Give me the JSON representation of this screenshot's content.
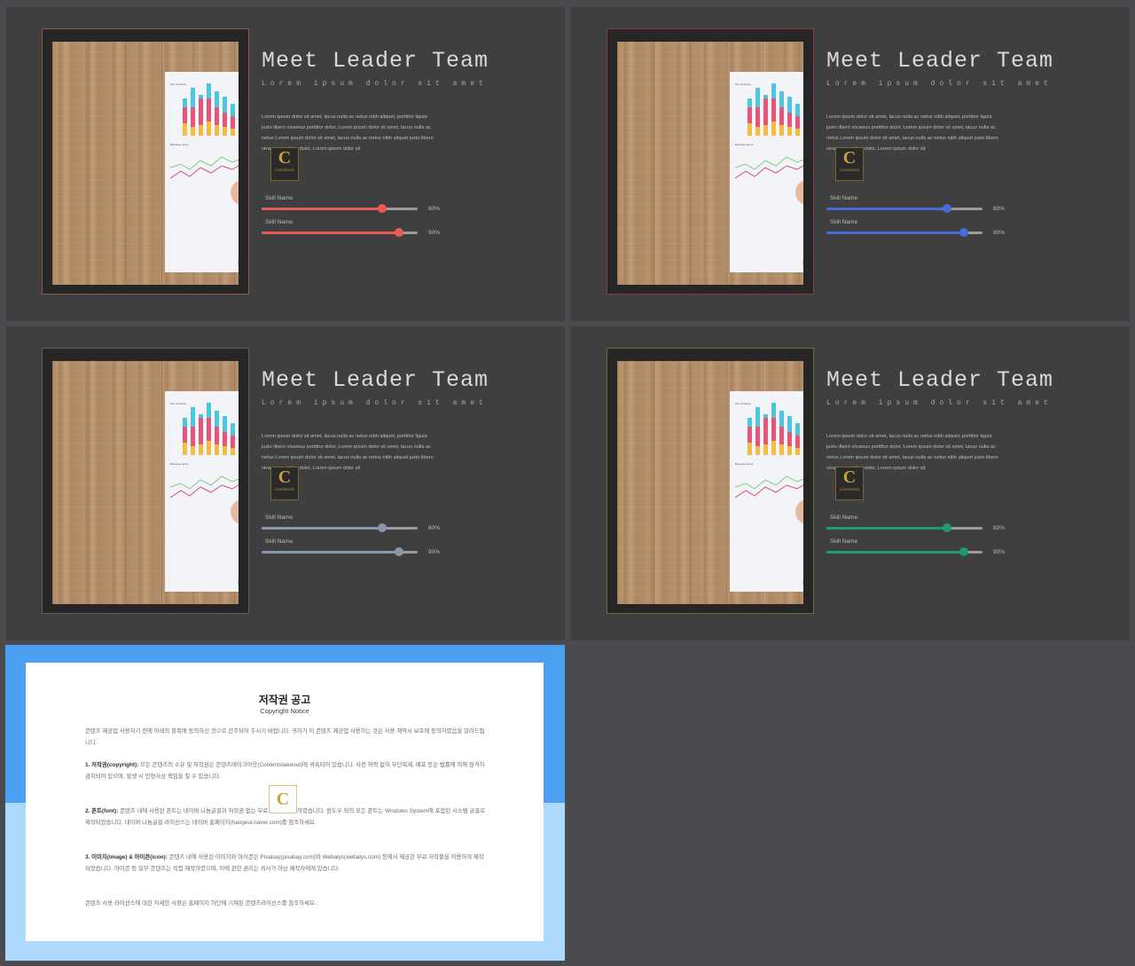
{
  "slides": [
    {
      "title": "Meet Leader Team",
      "subtitle": "Lorem ipsum dolor sit amet",
      "body": "Lorem ipsum dolor sit amet, lacus nulla ac netus nibh aliquet, porttitor ligula justo libero vivamus porttitor dolor, Lorem ipsum dolor sit amet, lacus nulla ac netus Lorem ipsum dolor sit amet, lacus nulla ac netus nibh aliquet justo libero vivamus porttitor dolor, Lorem ipsum dolor sit",
      "frame_color": "#8a5a4a",
      "accent": "#e85a5a",
      "skills": [
        {
          "label": "Skill Name",
          "value": "80%",
          "level": 0.77
        },
        {
          "label": "Skill Name",
          "value": "90%",
          "level": 0.88
        }
      ]
    },
    {
      "title": "Meet Leader Team",
      "subtitle": "Lorem ipsum dolor sit amet",
      "body": "Lorem ipsum dolor sit amet, lacus nulla ac netus nibh aliquet, porttitor ligula justo libero vivamus porttitor dolor, Lorem ipsum dolor sit amet, lacus nulla ac netus Lorem ipsum dolor sit amet, lacus nulla ac netus nibh aliquet justo libero vivamus porttitor dolor, Lorem ipsum dolor sit",
      "frame_color": "#8a3a4a",
      "accent": "#4a6ad8",
      "skills": [
        {
          "label": "Skill Name",
          "value": "80%",
          "level": 0.77
        },
        {
          "label": "Skill Name",
          "value": "90%",
          "level": 0.88
        }
      ]
    },
    {
      "title": "Meet Leader Team",
      "subtitle": "Lorem ipsum dolor sit amet",
      "body": "Lorem ipsum dolor sit amet, lacus nulla ac netus nibh aliquet, porttitor ligula justo libero vivamus porttitor dolor, Lorem ipsum dolor sit amet, lacus nulla ac netus Lorem ipsum dolor sit amet, lacus nulla ac netus nibh aliquet justo libero vivamus porttitor dolor, Lorem ipsum dolor sit",
      "frame_color": "#5a5f6a",
      "accent": "#8a96ac",
      "skills": [
        {
          "label": "Skill Name",
          "value": "80%",
          "level": 0.77
        },
        {
          "label": "Skill Name",
          "value": "90%",
          "level": 0.88
        }
      ]
    },
    {
      "title": "Meet Leader Team",
      "subtitle": "Lorem ipsum dolor sit amet",
      "body": "Lorem ipsum dolor sit amet, lacus nulla ac netus nibh aliquet, porttitor ligula justo libero vivamus porttitor dolor, Lorem ipsum dolor sit amet, lacus nulla ac netus Lorem ipsum dolor sit amet, lacus nulla ac netus nibh aliquet justo libero vivamus porttitor dolor, Lorem ipsum dolor sit",
      "frame_color": "#6a6f3a",
      "accent": "#1e9a72",
      "skills": [
        {
          "label": "Skill Name",
          "value": "80%",
          "level": 0.77
        },
        {
          "label": "Skill Name",
          "value": "90%",
          "level": 0.88
        }
      ]
    }
  ],
  "paper_labels": {
    "top": "Our company",
    "mid": "Business Items"
  },
  "logo_text": "CONTENTS",
  "notice": {
    "title": "저작권 공고",
    "subtitle": "Copyright Notice",
    "p0": "콘텐츠 제공업 사용하기 전에 아래의 항목에 동의하신 것으로 간주되어 주시기 바랍니다. 귀하가 이 콘텐츠 제공업 사용하는 것은 사용 계약서 보호에 동의하였음을 알려드립니다.",
    "p1_head": "1. 저작권(copyright):",
    "p1": " 모든 콘텐츠의 소유 및 저작권은 콘텐츠테이크아웃(Contentstakeout)에 귀속되어 있습니다. 사전 허락 없이 무단복제, 배포 등은 법률에 의해 엄격히 금지되어 있으며, 발생 시 민형사상 책임을 질 수 있습니다.",
    "p2_head": "2. 폰트(font):",
    "p2": " 콘텐츠 내에 사용된 폰트는 네이버 나눔글꼴과 저작권 없는 무료 폰트를 사용하였습니다. 윈도우 외의 모든 폰트는 Windows System에 포함된 시스템 글꼴로 제작되었습니다. 네이버 나눔글꼴 라이선스는 네이버 홈페이지(hangeul.naver.com)를 참조하세요.",
    "p3_head": "3. 이미지(image) & 아이콘(icon):",
    "p3": " 콘텐츠 내에 사용된 이미지와 아이콘은 Pixabay(pixabay.com)와 Webalys(webalys.com) 등에서 제공한 무료 저작물을 이용하여 제작되었습니다. 아이콘 등 일부 콘텐츠는 직접 제작하였으며, 이에 관한 권리는 귀사가 아닌 제작자에게 있습니다.",
    "p4": "콘텐츠 사용 라이선스에 대한 자세한 사항은 홈페이지 하단에 기재된 콘텐츠라이선스를 참조하세요."
  }
}
